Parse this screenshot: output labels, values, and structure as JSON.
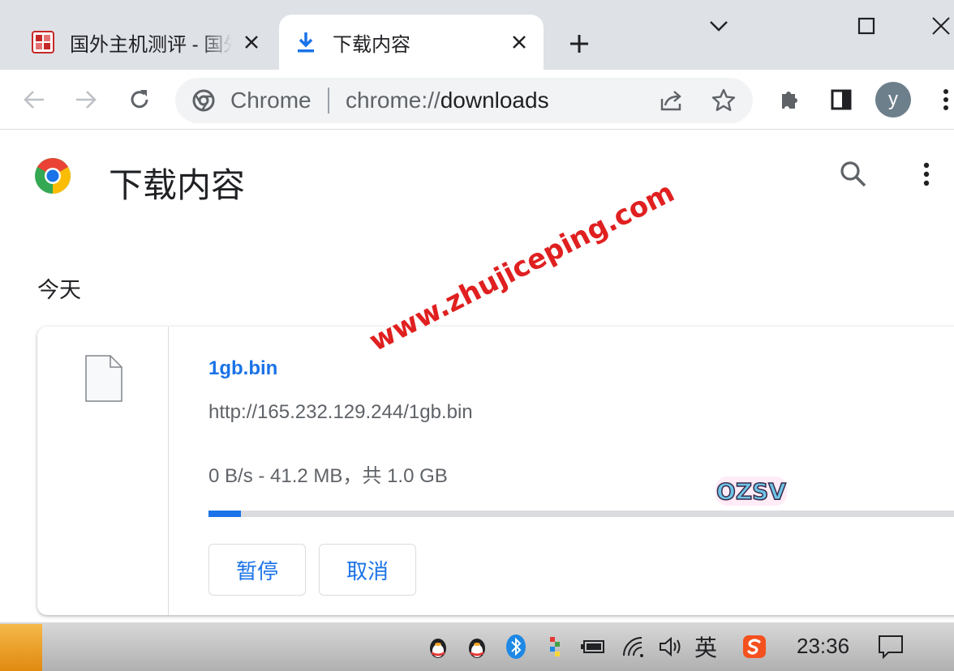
{
  "tabs": [
    {
      "title": "国外主机测评 - 国外",
      "active": false,
      "favicon": "site-seal-icon"
    },
    {
      "title": "下载内容",
      "active": true,
      "favicon": "download-icon"
    }
  ],
  "omnibox": {
    "chip": "Chrome",
    "url_scheme": "chrome://",
    "url_host": "downloads"
  },
  "profile": {
    "initial": "y"
  },
  "page": {
    "title": "下载内容",
    "section_date": "今天"
  },
  "download": {
    "file_name": "1gb.bin",
    "url": "http://165.232.129.244/1gb.bin",
    "status": "0 B/s - 41.2 MB，共 1.0 GB",
    "progress": 0.0412,
    "pause_label": "暂停",
    "cancel_label": "取消"
  },
  "watermark": {
    "text": "www.zhujiceping.com",
    "logo_text": "OZSV"
  },
  "taskbar": {
    "ime": "英",
    "clock": "23:36"
  },
  "colors": {
    "accent": "#1a73e8",
    "tabstrip": "#dee1e6",
    "watermark": "#e02020"
  }
}
